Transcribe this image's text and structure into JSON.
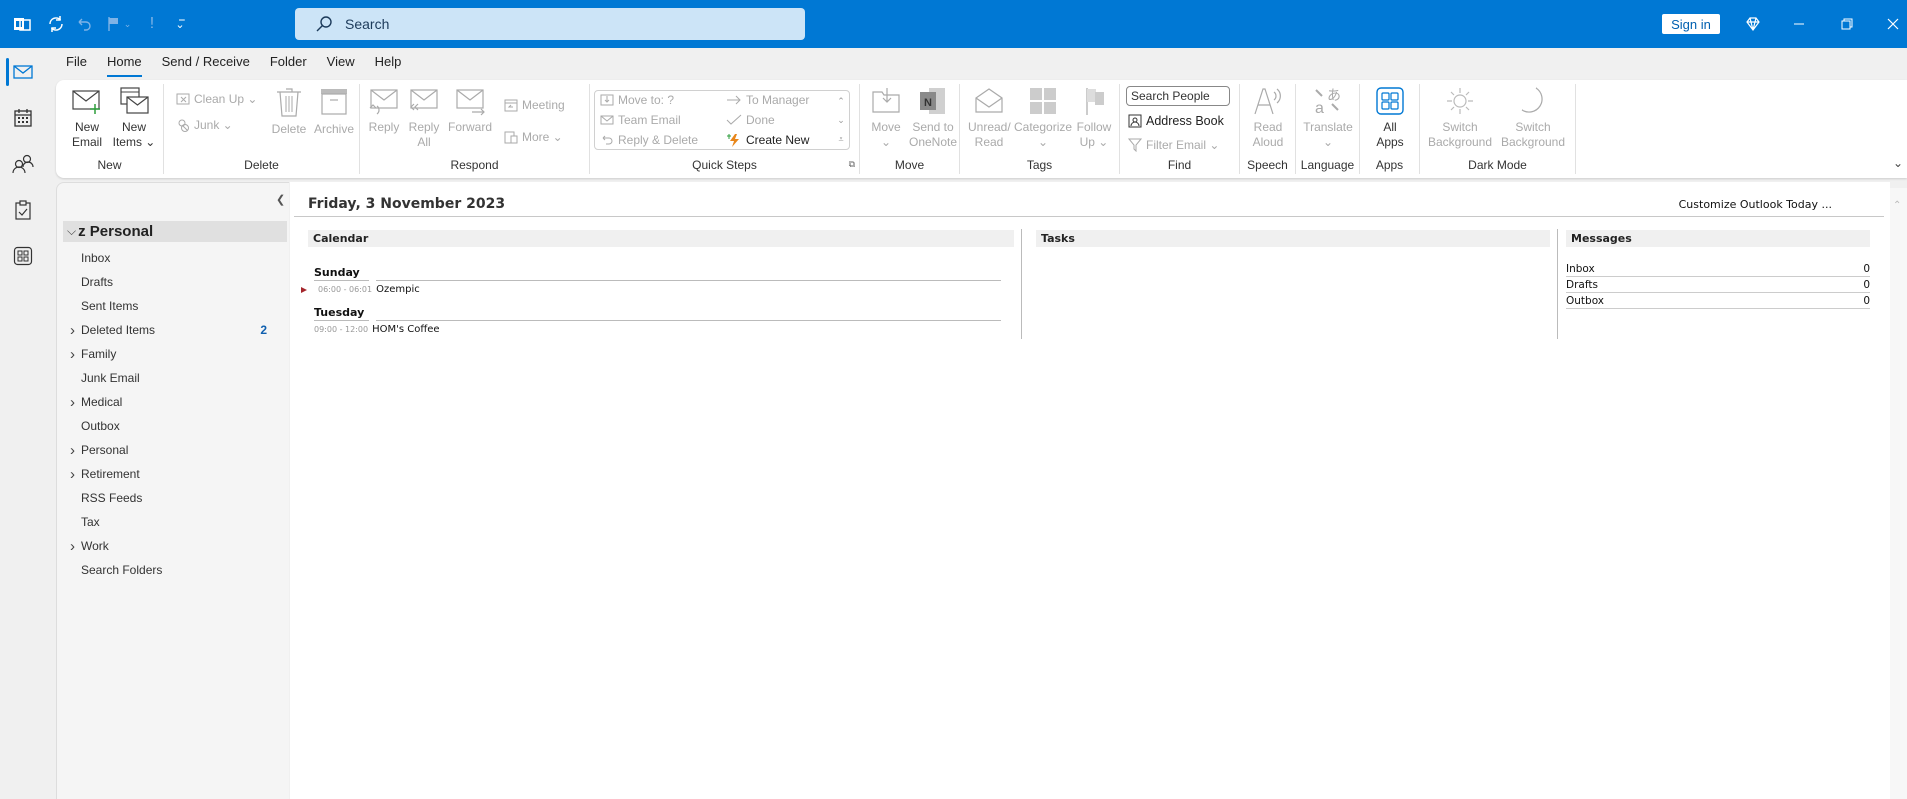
{
  "titlebar": {
    "search_placeholder": "Search",
    "sign_in": "Sign in",
    "quick_access": [
      "outlook-app-icon",
      "sync-icon",
      "undo-icon",
      "flag-icon",
      "importance-icon",
      "customize-qat-icon"
    ]
  },
  "menu": [
    "File",
    "Home",
    "Send / Receive",
    "Folder",
    "View",
    "Help"
  ],
  "menu_active": "Home",
  "ribbon": {
    "new": {
      "label": "New",
      "new_email": [
        "New",
        "Email"
      ],
      "new_items": [
        "New",
        "Items ⌄"
      ]
    },
    "delete": {
      "label": "Delete",
      "clean_up": "Clean Up ⌄",
      "junk": "Junk ⌄",
      "delete": "Delete",
      "archive": "Archive"
    },
    "respond": {
      "label": "Respond",
      "reply": "Reply",
      "reply_all": [
        "Reply",
        "All"
      ],
      "forward": "Forward",
      "meeting": "Meeting",
      "more": "More ⌄"
    },
    "quick_steps": {
      "label": "Quick Steps",
      "items": [
        "Move to: ?",
        "Team Email",
        "Reply & Delete",
        "To Manager",
        "Done",
        "Create New"
      ]
    },
    "move": {
      "label": "Move",
      "move": [
        "Move",
        "⌄"
      ],
      "onenote": [
        "Send to",
        "OneNote"
      ]
    },
    "tags": {
      "label": "Tags",
      "unread": [
        "Unread/",
        "Read"
      ],
      "categorize": [
        "Categorize",
        "⌄"
      ],
      "follow_up": [
        "Follow",
        "Up ⌄"
      ]
    },
    "find": {
      "label": "Find",
      "search_people": "Search People",
      "address_book": "Address Book",
      "filter_email": "Filter Email ⌄"
    },
    "speech": {
      "label": "Speech",
      "read_aloud": [
        "Read",
        "Aloud"
      ]
    },
    "language": {
      "label": "Language",
      "translate": [
        "Translate",
        "⌄"
      ]
    },
    "apps": {
      "label": "Apps",
      "all_apps": [
        "All",
        "Apps"
      ]
    },
    "dark_mode": {
      "label": "Dark Mode",
      "switch1": [
        "Switch",
        "Background"
      ],
      "switch2": [
        "Switch",
        "Background"
      ]
    }
  },
  "nav": {
    "account": "z Personal",
    "folders": [
      {
        "name": "Inbox",
        "expandable": false,
        "count": ""
      },
      {
        "name": "Drafts",
        "expandable": false,
        "count": ""
      },
      {
        "name": "Sent Items",
        "expandable": false,
        "count": ""
      },
      {
        "name": "Deleted Items",
        "expandable": true,
        "count": "2"
      },
      {
        "name": "Family",
        "expandable": true,
        "count": ""
      },
      {
        "name": "Junk Email",
        "expandable": false,
        "count": ""
      },
      {
        "name": "Medical",
        "expandable": true,
        "count": ""
      },
      {
        "name": "Outbox",
        "expandable": false,
        "count": ""
      },
      {
        "name": "Personal",
        "expandable": true,
        "count": ""
      },
      {
        "name": "Retirement",
        "expandable": true,
        "count": ""
      },
      {
        "name": "RSS Feeds",
        "expandable": false,
        "count": ""
      },
      {
        "name": "Tax",
        "expandable": false,
        "count": ""
      },
      {
        "name": "Work",
        "expandable": true,
        "count": ""
      },
      {
        "name": "Search Folders",
        "expandable": false,
        "count": ""
      }
    ]
  },
  "today": {
    "date": "Friday, 3 November 2023",
    "customize": "Customize Outlook Today ...",
    "calendar": {
      "title": "Calendar",
      "days": [
        {
          "day": "Sunday",
          "items": [
            {
              "time": "06:00 - 06:01",
              "subject": "Ozempic",
              "flag": true
            }
          ]
        },
        {
          "day": "Tuesday",
          "items": [
            {
              "time": "09:00 - 12:00",
              "subject": "HOM's Coffee",
              "flag": false
            }
          ]
        }
      ]
    },
    "tasks": {
      "title": "Tasks"
    },
    "messages": {
      "title": "Messages",
      "rows": [
        {
          "name": "Inbox",
          "count": "0"
        },
        {
          "name": "Drafts",
          "count": "0"
        },
        {
          "name": "Outbox",
          "count": "0"
        }
      ]
    }
  },
  "colors": {
    "accent": "#0078d4",
    "count": "#0f5fae",
    "flag": "#a4262c"
  }
}
